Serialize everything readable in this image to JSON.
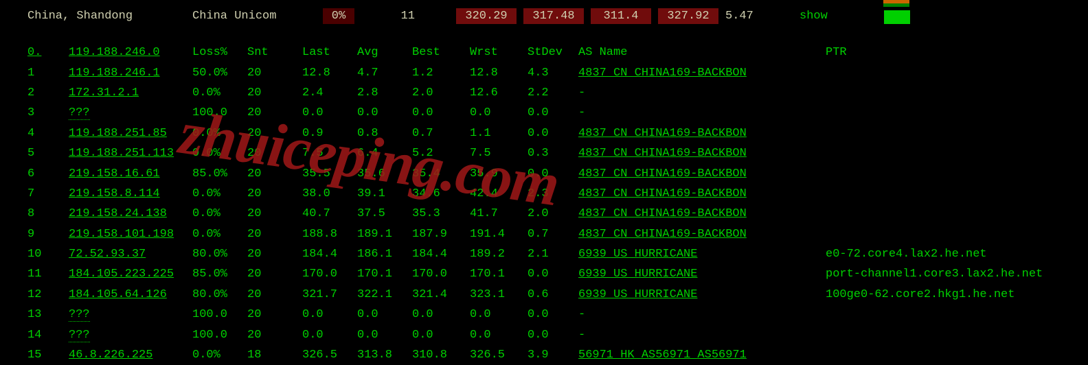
{
  "header": {
    "location": "China, Shandong",
    "provider": "China Unicom",
    "loss": "0%",
    "snt": "11",
    "stats": [
      "320.29",
      "317.48",
      "311.4",
      "327.92"
    ],
    "stdev": "5.47",
    "show": "show"
  },
  "columns": {
    "idx0": "0.",
    "ip0": "119.188.246.0",
    "loss": "Loss%",
    "snt": "Snt",
    "last": "Last",
    "avg": "Avg",
    "best": "Best",
    "wrst": "Wrst",
    "stdev": "StDev",
    "asname": "AS Name",
    "ptr": "PTR"
  },
  "hops": [
    {
      "idx": "1",
      "ip": "119.188.246.1",
      "loss": "50.0%",
      "snt": "20",
      "last": "12.8",
      "avg": "4.7",
      "best": "1.2",
      "wrst": "12.8",
      "stdev": "4.3",
      "as": "4837  CN CHINA169-BACKBON",
      "ptr": ""
    },
    {
      "idx": "2",
      "ip": "172.31.2.1",
      "loss": "0.0%",
      "snt": "20",
      "last": "2.4",
      "avg": "2.8",
      "best": "2.0",
      "wrst": "12.6",
      "stdev": "2.2",
      "as": "-",
      "ptr": ""
    },
    {
      "idx": "3",
      "ip": "???",
      "loss": "100.0",
      "snt": "20",
      "last": "0.0",
      "avg": "0.0",
      "best": "0.0",
      "wrst": "0.0",
      "stdev": "0.0",
      "as": "-",
      "ptr": ""
    },
    {
      "idx": "4",
      "ip": "119.188.251.85",
      "loss": "0.0%",
      "snt": "20",
      "last": "0.9",
      "avg": "0.8",
      "best": "0.7",
      "wrst": "1.1",
      "stdev": "0.0",
      "as": "4837  CN CHINA169-BACKBON",
      "ptr": ""
    },
    {
      "idx": "5",
      "ip": "119.188.251.113",
      "loss": "0.0%",
      "snt": "20",
      "last": "7.5",
      "avg": "6.4",
      "best": "5.2",
      "wrst": "7.5",
      "stdev": "0.3",
      "as": "4837  CN CHINA169-BACKBON",
      "ptr": ""
    },
    {
      "idx": "6",
      "ip": "219.158.16.61",
      "loss": "85.0%",
      "snt": "20",
      "last": "35.5",
      "avg": "35.6",
      "best": "35.4",
      "wrst": "35.9",
      "stdev": "0.0",
      "as": "4837  CN CHINA169-BACKBON",
      "ptr": ""
    },
    {
      "idx": "7",
      "ip": "219.158.8.114",
      "loss": "0.0%",
      "snt": "20",
      "last": "38.0",
      "avg": "39.1",
      "best": "34.6",
      "wrst": "42.4",
      "stdev": "2.3",
      "as": "4837  CN CHINA169-BACKBON",
      "ptr": ""
    },
    {
      "idx": "8",
      "ip": "219.158.24.138",
      "loss": "0.0%",
      "snt": "20",
      "last": "40.7",
      "avg": "37.5",
      "best": "35.3",
      "wrst": "41.7",
      "stdev": "2.0",
      "as": "4837  CN CHINA169-BACKBON",
      "ptr": ""
    },
    {
      "idx": "9",
      "ip": "219.158.101.198",
      "loss": "0.0%",
      "snt": "20",
      "last": "188.8",
      "avg": "189.1",
      "best": "187.9",
      "wrst": "191.4",
      "stdev": "0.7",
      "as": "4837  CN CHINA169-BACKBON",
      "ptr": ""
    },
    {
      "idx": "10",
      "ip": "72.52.93.37",
      "loss": "80.0%",
      "snt": "20",
      "last": "184.4",
      "avg": "186.1",
      "best": "184.4",
      "wrst": "189.2",
      "stdev": "2.1",
      "as": "6939  US HURRICANE",
      "ptr": "e0-72.core4.lax2.he.net"
    },
    {
      "idx": "11",
      "ip": "184.105.223.225",
      "loss": "85.0%",
      "snt": "20",
      "last": "170.0",
      "avg": "170.1",
      "best": "170.0",
      "wrst": "170.1",
      "stdev": "0.0",
      "as": "6939  US HURRICANE",
      "ptr": "port-channel1.core3.lax2.he.net"
    },
    {
      "idx": "12",
      "ip": "184.105.64.126",
      "loss": "80.0%",
      "snt": "20",
      "last": "321.7",
      "avg": "322.1",
      "best": "321.4",
      "wrst": "323.1",
      "stdev": "0.6",
      "as": "6939  US HURRICANE",
      "ptr": "100ge0-62.core2.hkg1.he.net"
    },
    {
      "idx": "13",
      "ip": "???",
      "loss": "100.0",
      "snt": "20",
      "last": "0.0",
      "avg": "0.0",
      "best": "0.0",
      "wrst": "0.0",
      "stdev": "0.0",
      "as": "-",
      "ptr": ""
    },
    {
      "idx": "14",
      "ip": "???",
      "loss": "100.0",
      "snt": "20",
      "last": "0.0",
      "avg": "0.0",
      "best": "0.0",
      "wrst": "0.0",
      "stdev": "0.0",
      "as": "-",
      "ptr": ""
    },
    {
      "idx": "15",
      "ip": "46.8.226.225",
      "loss": "0.0%",
      "snt": "18",
      "last": "326.5",
      "avg": "313.8",
      "best": "310.8",
      "wrst": "326.5",
      "stdev": "3.9",
      "as": "56971 HK AS56971 AS56971",
      "ptr": ""
    }
  ],
  "watermark": "zhuiceping.com"
}
